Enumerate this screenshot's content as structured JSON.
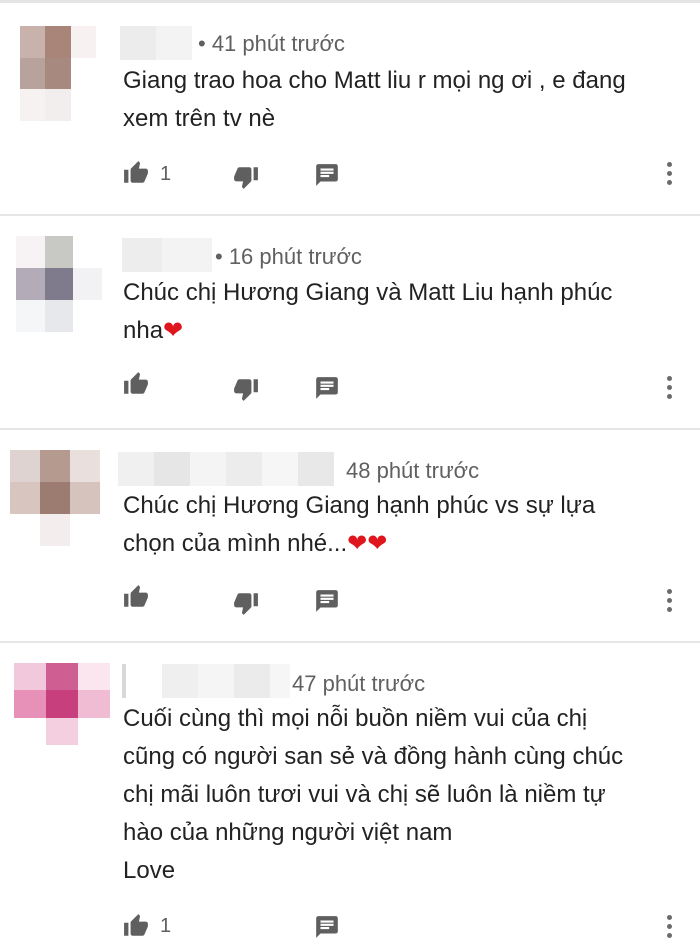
{
  "comments": [
    {
      "time": "• 41 phút trước",
      "lines": [
        "Giang trao hoa cho Matt liu r mọi ng ơi , e đang",
        "xem trên tv nè"
      ],
      "heart_suffix": "",
      "like_count": "1",
      "avatar_colors": [
        "#c9b2ac",
        "#a88578",
        "#f7f2f1",
        "#b7a39c",
        "#a8897f",
        "#ffffff",
        "#f6f2f1",
        "#f2eeee",
        "#ffffff"
      ]
    },
    {
      "time": "• 16 phút trước",
      "lines": [
        "Chúc chị Hương Giang và Matt Liu hạnh phúc",
        "nha"
      ],
      "heart_suffix": "❤",
      "like_count": "",
      "avatar_colors": [
        "#f7f3f5",
        "#c8c9c4",
        "#ffffff",
        "#b3abb7",
        "#7f7b8d",
        "#f2f1f4",
        "#f5f6f8",
        "#e7e8ec",
        "#ffffff"
      ]
    },
    {
      "time": "48 phút trước",
      "lines": [
        "Chúc chị Hương Giang hạnh phúc vs sự lựa",
        "chọn của mình  nhé..."
      ],
      "heart_suffix": "❤❤",
      "like_count": "",
      "avatar_colors": [
        "#ded3d1",
        "#b59a90",
        "#e9dfdd",
        "#d9c5c0",
        "#9c7c70",
        "#d7c3bd",
        "#ffffff",
        "#f3eeed",
        "#ffffff"
      ]
    },
    {
      "time": "47 phút trước",
      "lines": [
        "Cuối cùng thì mọi nỗi buồn niềm vui của chị",
        "cũng có người san sẻ và đồng hành cùng chúc",
        "chị mãi luôn tươi vui và chị sẽ luôn là niềm tự",
        "hào của những người việt nam",
        "Love"
      ],
      "heart_suffix": "",
      "like_count": "1",
      "avatar_colors": [
        "#f2c9dc",
        "#cf5f92",
        "#fbe6ef",
        "#e891b8",
        "#c83f7d",
        "#f0bcd3",
        "#ffffff",
        "#f4cfe0",
        "#ffffff"
      ]
    }
  ],
  "icons": {
    "like": "thumb-up-icon",
    "dislike": "thumb-down-icon",
    "reply": "comment-icon",
    "more": "more-vert-icon"
  }
}
